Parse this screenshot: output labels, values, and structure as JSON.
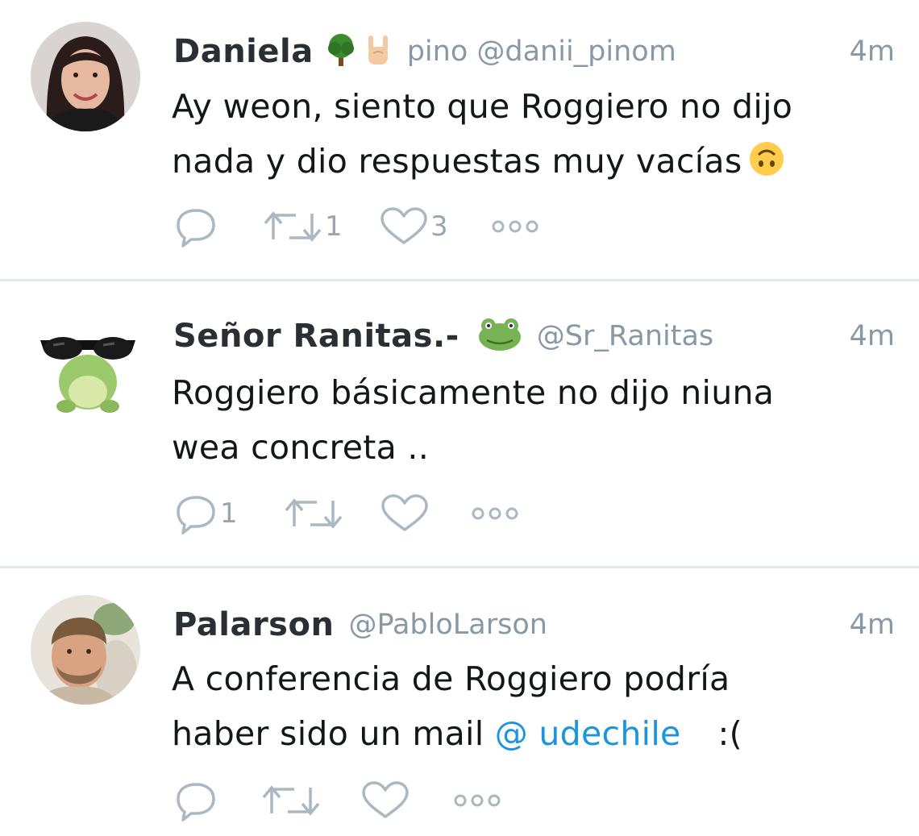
{
  "tweets": [
    {
      "name": "Daniela",
      "emojis": [
        "tree-emoji",
        "rock-hand-emoji"
      ],
      "handle": "pino @danii_pinom",
      "time": "4m",
      "line1": "Ay weon, siento que Roggiero no dijo",
      "line2": "nada y dio respuestas muy vacías",
      "trailing_emoji": "upside-down-face-emoji",
      "reply_count": "",
      "retweet_count": "1",
      "like_count": "3"
    },
    {
      "name": "Señor Ranitas.-",
      "emojis": [
        "frog-emoji"
      ],
      "handle": "@Sr_Ranitas",
      "time": "4m",
      "line1": "Roggiero básicamente no dijo niuna",
      "line2": "wea concreta ..",
      "reply_count": "1",
      "retweet_count": "",
      "like_count": ""
    },
    {
      "name": "Palarson",
      "handle": "@PabloLarson",
      "time": "4m",
      "line1": "A conferencia de Roggiero podría",
      "line2_prefix": "haber sido un mail ",
      "line2_mention": "@ udechile",
      "line2_suffix": ":(",
      "reply_count": "",
      "retweet_count": "",
      "like_count": ""
    }
  ],
  "colors": {
    "text": "#14171a",
    "secondary": "#8899a6",
    "link": "#1b95e0",
    "divider": "#e1e8ed",
    "icon": "#aab8c2"
  }
}
